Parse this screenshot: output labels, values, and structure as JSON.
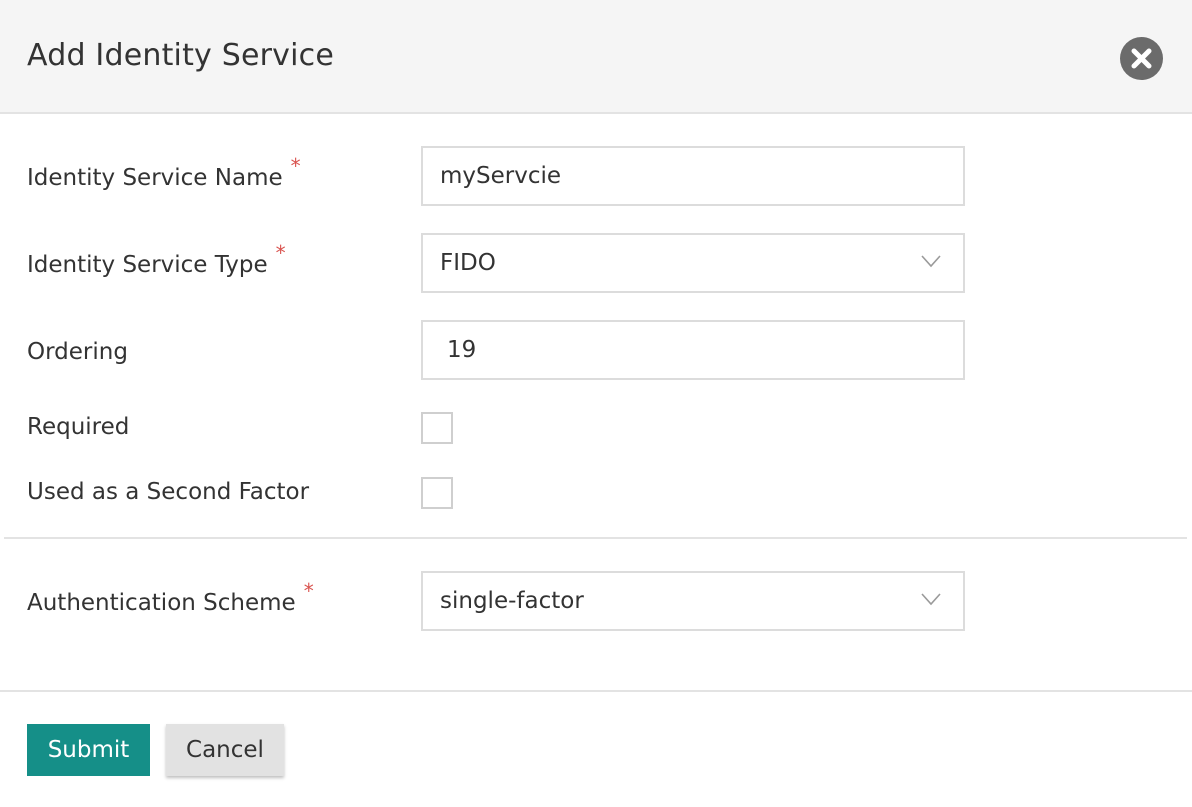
{
  "dialog": {
    "title": "Add Identity Service",
    "close_icon": "close-circle-icon"
  },
  "form": {
    "name": {
      "label": "Identity Service Name",
      "required_marker": "*",
      "value": "myServcie"
    },
    "type": {
      "label": "Identity Service Type",
      "required_marker": "*",
      "value": "FIDO",
      "icon": "chevron-down-icon"
    },
    "ordering": {
      "label": "Ordering",
      "value": "19"
    },
    "required": {
      "label": "Required",
      "checked": false
    },
    "second_factor": {
      "label": "Used as a Second Factor",
      "checked": false
    },
    "auth_scheme": {
      "label": "Authentication Scheme",
      "required_marker": "*",
      "value": "single-factor",
      "icon": "chevron-down-icon"
    }
  },
  "footer": {
    "submit_label": "Submit",
    "cancel_label": "Cancel"
  },
  "colors": {
    "primary": "#158f88",
    "required": "#d9534f",
    "header_bg": "#f5f5f5",
    "close_bg": "#6b6b6b"
  }
}
